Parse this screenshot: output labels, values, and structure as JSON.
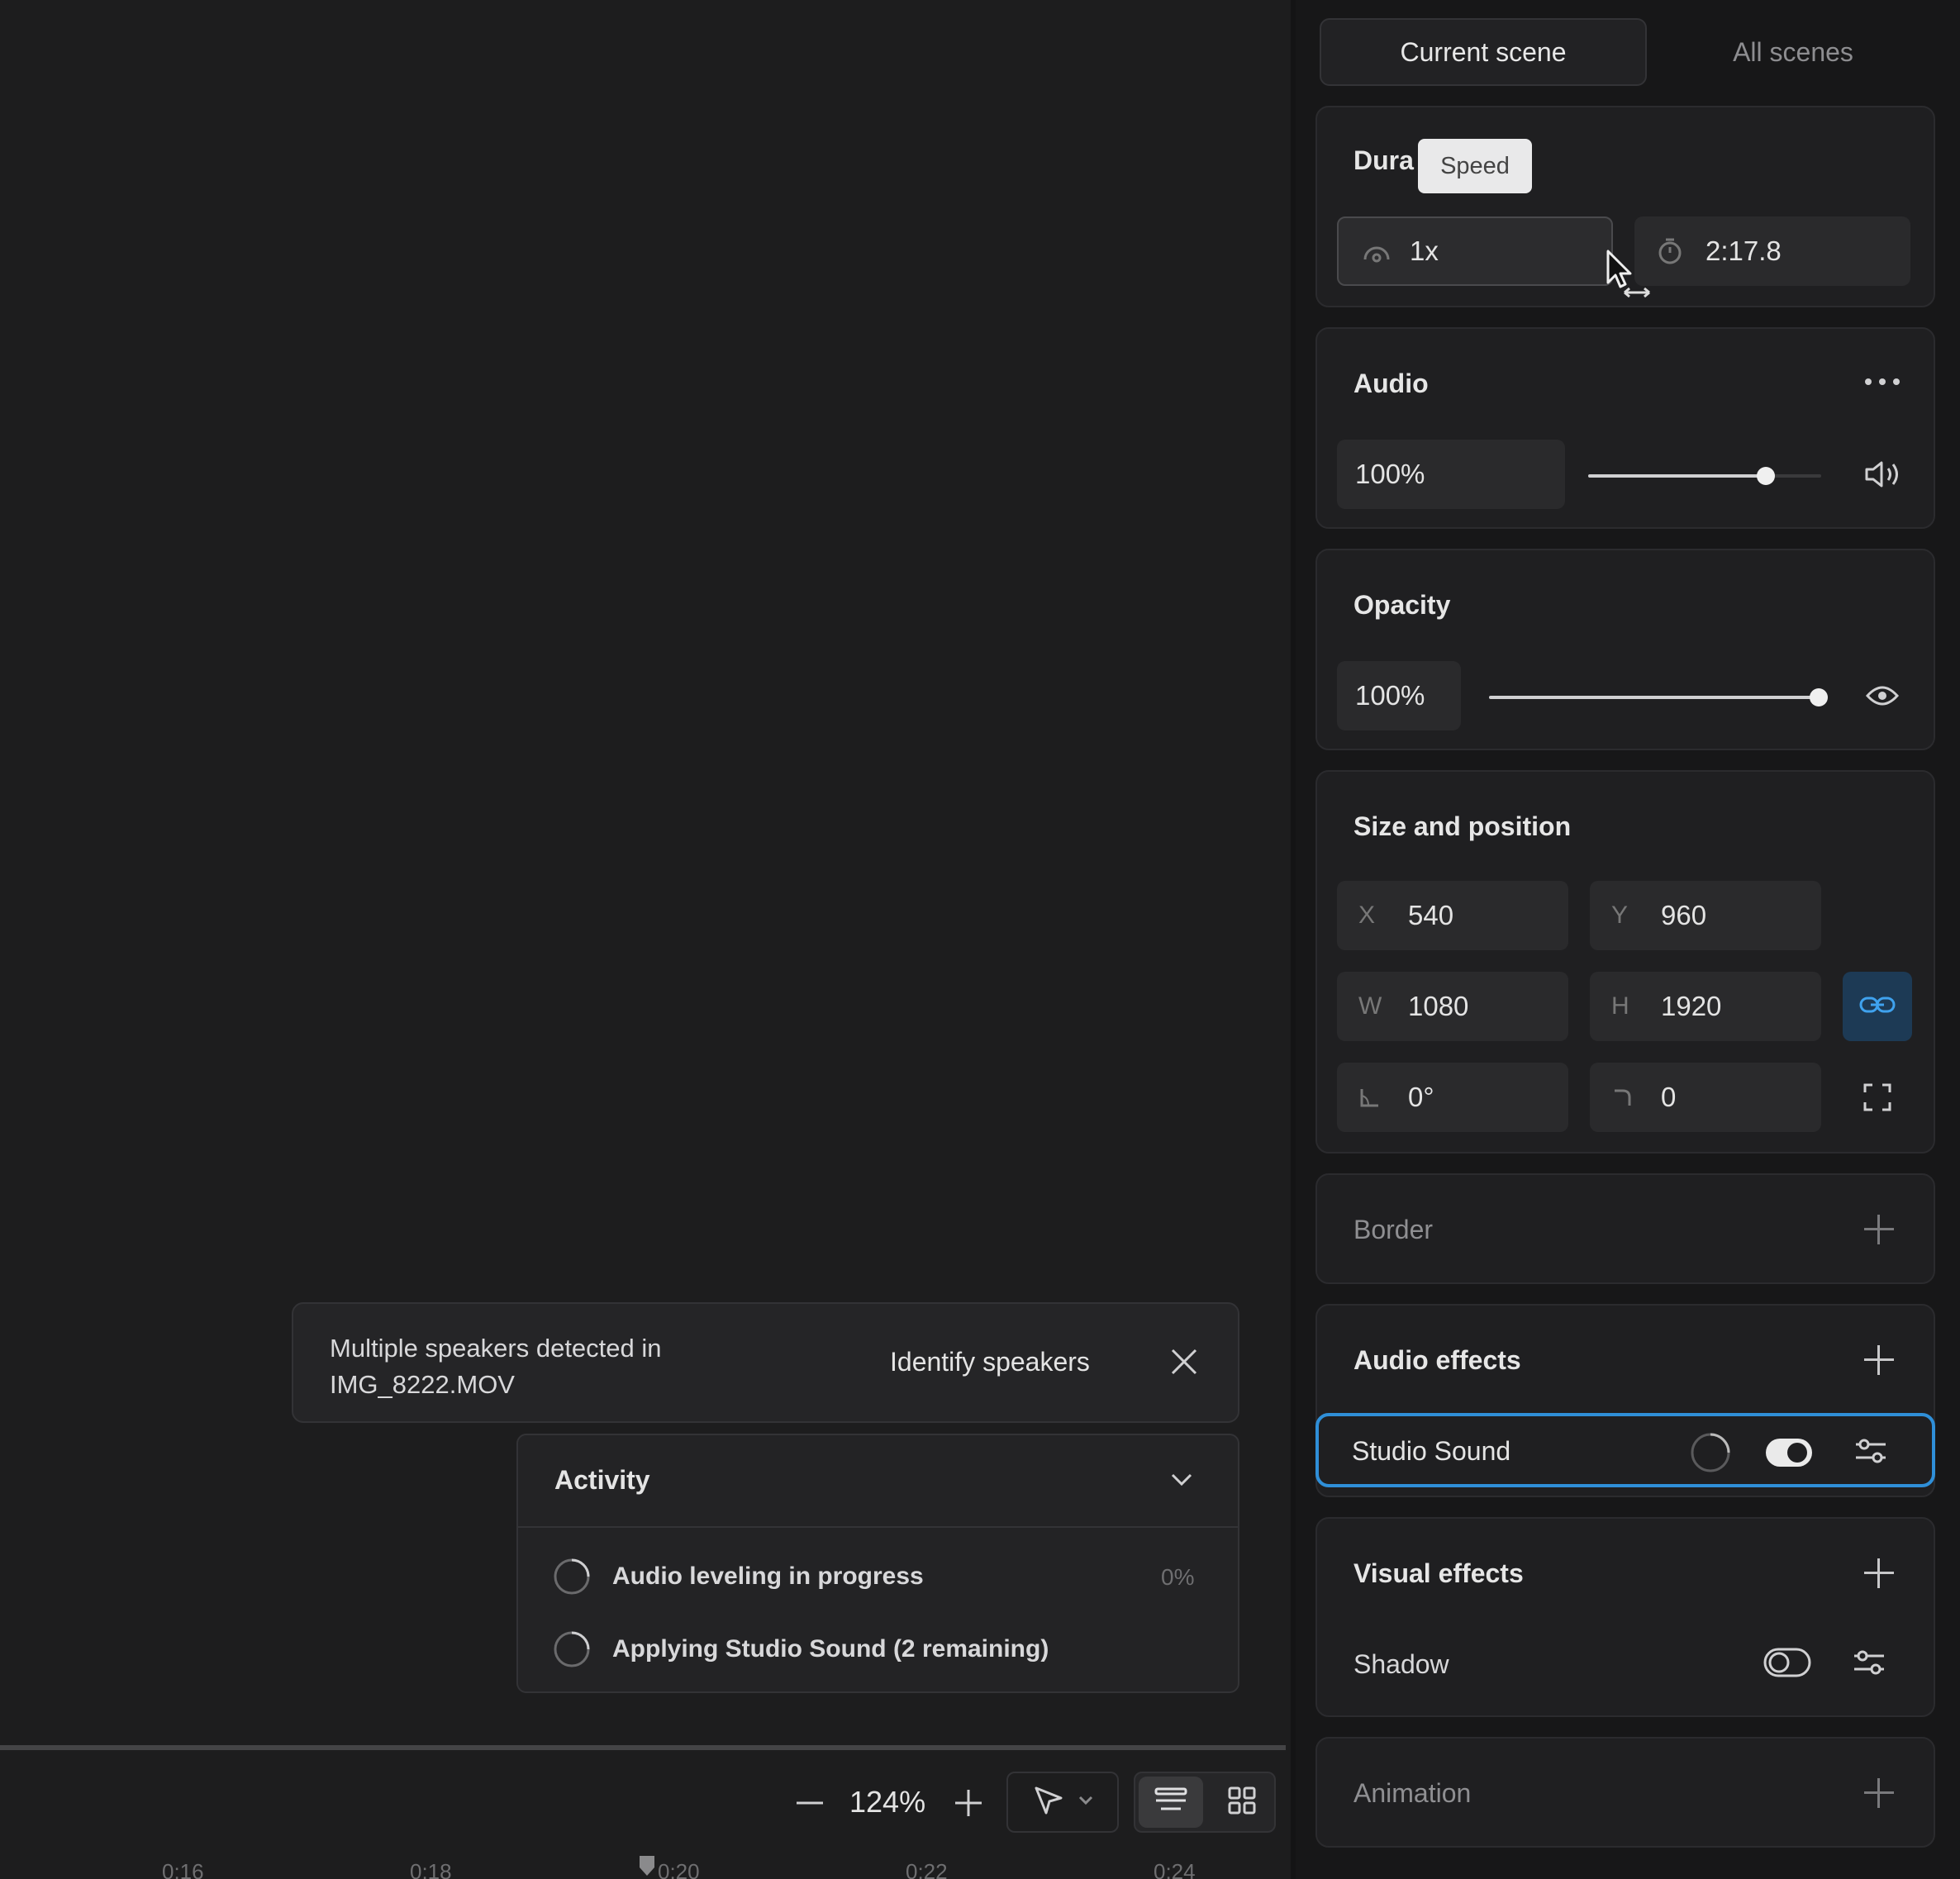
{
  "tabs": {
    "current": "Current scene",
    "all": "All scenes"
  },
  "tooltip": {
    "label": "Speed"
  },
  "duration": {
    "title": "Dura",
    "speed_value": "1x",
    "time_value": "2:17.8"
  },
  "audio": {
    "title": "Audio",
    "volume_value": "100%",
    "volume_level": 0.76
  },
  "opacity": {
    "title": "Opacity",
    "value": "100%",
    "level": 1.0
  },
  "size_position": {
    "title": "Size and position",
    "x_label": "X",
    "x_value": "540",
    "y_label": "Y",
    "y_value": "960",
    "w_label": "W",
    "w_value": "1080",
    "h_label": "H",
    "h_value": "1920",
    "rotation_value": "0°",
    "radius_value": "0"
  },
  "border": {
    "title": "Border"
  },
  "audio_effects": {
    "title": "Audio effects",
    "item_label": "Studio Sound",
    "item_enabled": true
  },
  "visual_effects": {
    "title": "Visual effects",
    "item_label": "Shadow",
    "item_enabled": false
  },
  "animation": {
    "title": "Animation"
  },
  "toast": {
    "message_line1": "Multiple speakers detected in",
    "message_line2": "IMG_8222.MOV",
    "action_label": "Identify speakers"
  },
  "activity": {
    "title": "Activity",
    "items": [
      {
        "label": "Audio leveling in progress",
        "progress": "0%"
      },
      {
        "label": "Applying Studio Sound (2 remaining)",
        "progress": ""
      }
    ]
  },
  "toolbar": {
    "zoom_value": "124%"
  },
  "timeline": {
    "ticks": [
      "0:16",
      "0:18",
      "0:20",
      "0:22",
      "0:24"
    ]
  },
  "colors": {
    "accent": "#2f8fd8",
    "link_button": "#1d3a55"
  }
}
